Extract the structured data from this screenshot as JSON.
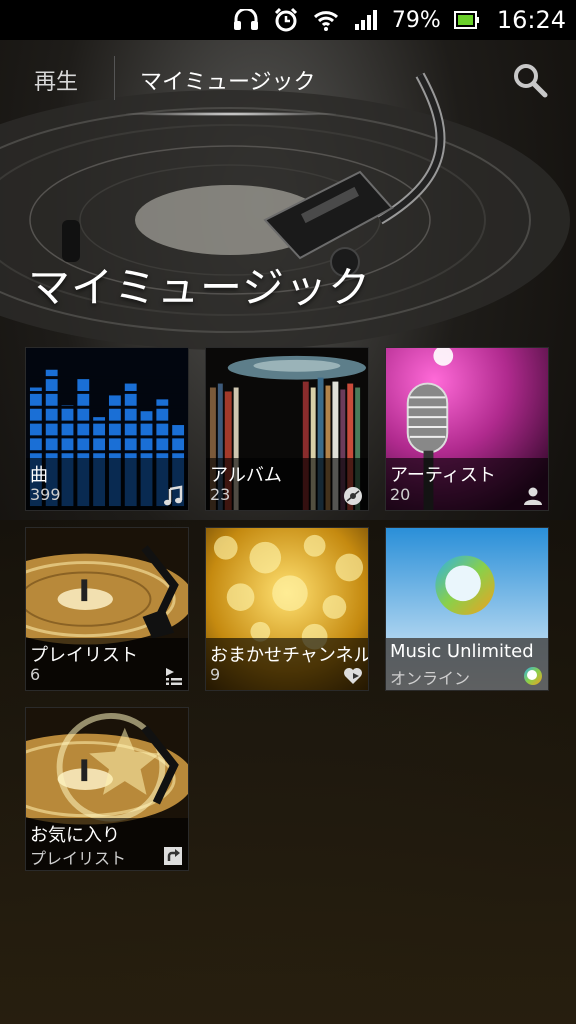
{
  "status_bar": {
    "battery_percent": "79%",
    "time": "16:24",
    "icons": [
      "headset-icon",
      "alarm-icon",
      "wifi-icon",
      "signal-icon",
      "battery-icon"
    ]
  },
  "action_bar": {
    "tab_play": "再生",
    "tab_my_music": "マイミュージック",
    "search_icon": "search-icon"
  },
  "heading": "マイミュージック",
  "tiles": [
    {
      "label": "曲",
      "sub": "399",
      "icon": "music-note-icon"
    },
    {
      "label": "アルバム",
      "sub": "23",
      "icon": "disc-icon"
    },
    {
      "label": "アーティスト",
      "sub": "20",
      "icon": "person-icon"
    },
    {
      "label": "プレイリスト",
      "sub": "6",
      "icon": "playlist-icon"
    },
    {
      "label": "おまかせチャンネル",
      "sub": "9",
      "icon": "heart-icon"
    },
    {
      "label": "Music Unlimited",
      "sub": "オンライン",
      "icon": "music-unlimited-icon"
    },
    {
      "label": "お気に入り",
      "sub": "プレイリスト",
      "icon": "shortcut-arrow-icon"
    }
  ]
}
